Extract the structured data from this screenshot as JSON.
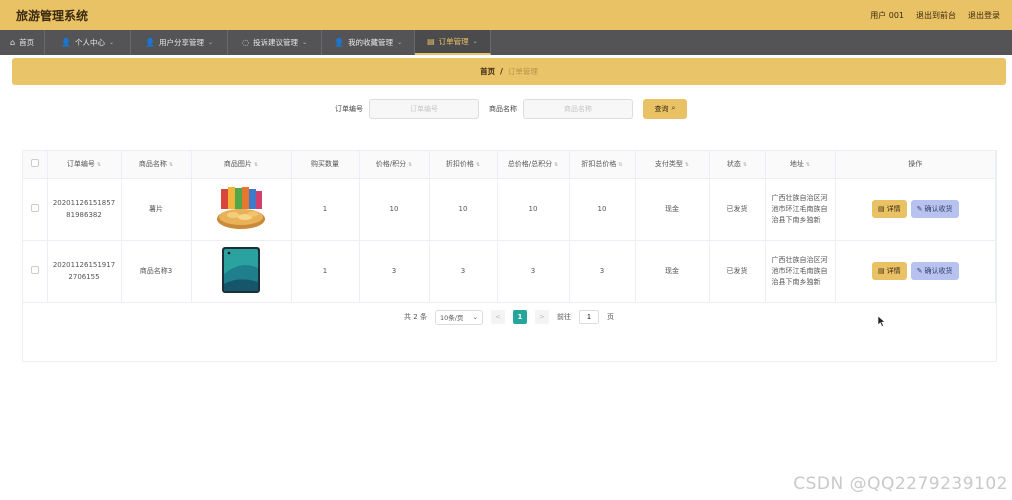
{
  "header": {
    "app_title": "旅游管理系统",
    "user": "用户 001",
    "back_to_front": "退出到前台",
    "logout": "退出登录"
  },
  "nav": [
    {
      "label": "首页",
      "icon": "home-icon",
      "has_chevron": false,
      "active": false
    },
    {
      "label": "个人中心",
      "icon": "user-icon",
      "has_chevron": true,
      "active": false
    },
    {
      "label": "用户分享管理",
      "icon": "user-icon",
      "has_chevron": true,
      "active": false
    },
    {
      "label": "投诉建议管理",
      "icon": "chat-icon",
      "has_chevron": true,
      "active": false
    },
    {
      "label": "我的收藏管理",
      "icon": "user-icon",
      "has_chevron": true,
      "active": false
    },
    {
      "label": "订单管理",
      "icon": "list-icon",
      "has_chevron": true,
      "active": true
    }
  ],
  "breadcrumb": {
    "home": "首页",
    "separator": "/",
    "current": "订单管理"
  },
  "search": {
    "order_no_label": "订单编号",
    "order_no_placeholder": "订单编号",
    "product_label": "商品名称",
    "product_placeholder": "商品名称",
    "query_button": "查询"
  },
  "table": {
    "headers": [
      "订单编号",
      "商品名称",
      "商品图片",
      "购买数量",
      "价格/积分",
      "折扣价格",
      "总价格/总积分",
      "折扣总价格",
      "支付类型",
      "状态",
      "地址",
      "操作"
    ],
    "rows": [
      {
        "order_no": "2020112615185781986382",
        "product_name": "薯片",
        "image": "chips-image",
        "quantity": "1",
        "price": "10",
        "discount_price": "10",
        "total": "10",
        "discount_total": "10",
        "pay_type": "现金",
        "status": "已发货",
        "address": "广西壮族自治区河池市环江毛南族自治县下南乡独新",
        "detail_button": "详情",
        "confirm_button": "确认收货"
      },
      {
        "order_no": "202011261519172706155",
        "product_name": "商品名称3",
        "image": "phone-image",
        "quantity": "1",
        "price": "3",
        "discount_price": "3",
        "total": "3",
        "discount_total": "3",
        "pay_type": "现金",
        "status": "已发货",
        "address": "广西壮族自治区河池市环江毛南族自治县下南乡独新",
        "detail_button": "详情",
        "confirm_button": "确认收货"
      }
    ]
  },
  "pagination": {
    "total": "共 2 条",
    "page_size": "10条/页",
    "prev": "<",
    "current_page": "1",
    "next": ">",
    "goto_label": "前往",
    "goto_value": "1",
    "page_suffix": "页"
  },
  "watermark": "CSDN @QQ2279239102",
  "colors": {
    "accent": "#e9c266",
    "nav_bg": "#545456",
    "page_active": "#26a69a",
    "confirm_btn": "#b8c2ee"
  }
}
